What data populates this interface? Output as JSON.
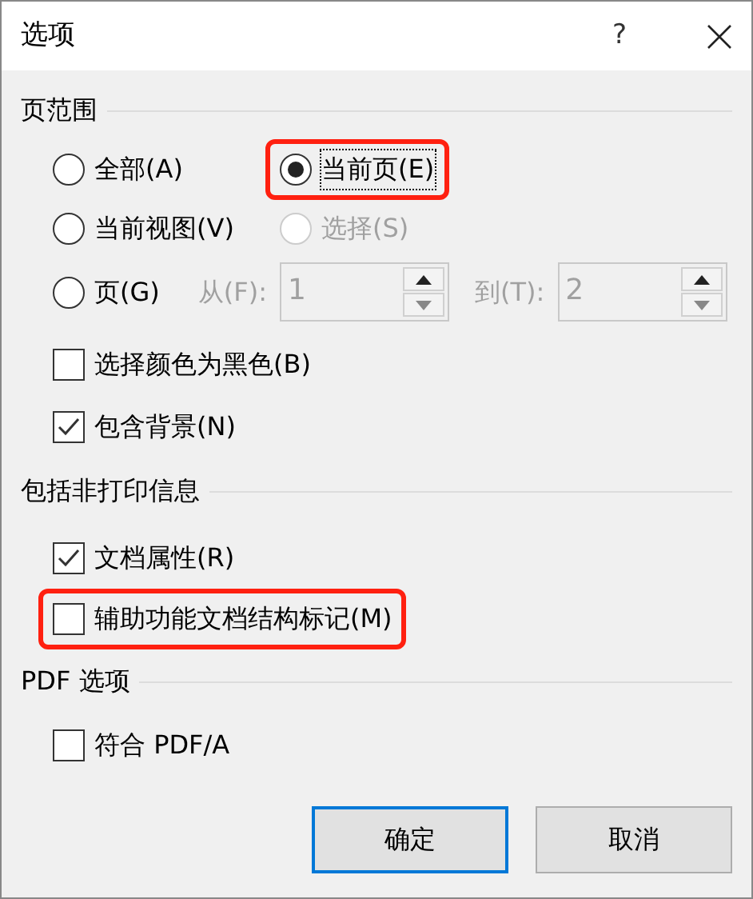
{
  "window": {
    "title": "选项",
    "help": "?"
  },
  "page_range": {
    "title": "页范围",
    "options": [
      {
        "label": "全部(A)",
        "selected": false,
        "disabled": false,
        "highlighted": false
      },
      {
        "label": "当前页(E)",
        "selected": true,
        "disabled": false,
        "highlighted": true
      },
      {
        "label": "当前视图(V)",
        "selected": false,
        "disabled": false,
        "highlighted": false
      },
      {
        "label": "选择(S)",
        "selected": false,
        "disabled": true,
        "highlighted": false
      },
      {
        "label": "页(G)",
        "selected": false,
        "disabled": false,
        "highlighted": false
      }
    ],
    "from": {
      "label": "从(F):",
      "value": "1",
      "disabled": true
    },
    "to": {
      "label": "到(T):",
      "value": "2",
      "disabled": true
    },
    "checks": [
      {
        "label": "选择颜色为黑色(B)",
        "checked": false,
        "highlighted": false
      },
      {
        "label": "包含背景(N)",
        "checked": true,
        "highlighted": false
      }
    ]
  },
  "non_print": {
    "title": "包括非打印信息",
    "checks": [
      {
        "label": "文档属性(R)",
        "checked": true,
        "highlighted": false
      },
      {
        "label": "辅助功能文档结构标记(M)",
        "checked": false,
        "highlighted": true
      }
    ]
  },
  "pdf": {
    "title": "PDF 选项",
    "checks": [
      {
        "label": "符合 PDF/A",
        "checked": false,
        "highlighted": false
      }
    ]
  },
  "buttons": [
    {
      "label": "确定",
      "default": true
    },
    {
      "label": "取消",
      "default": false
    }
  ]
}
